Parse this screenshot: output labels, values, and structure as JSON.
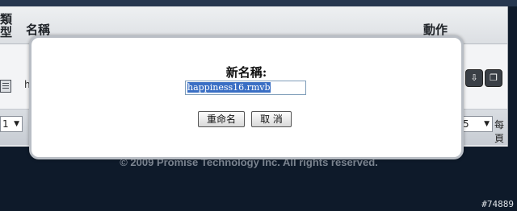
{
  "table": {
    "header_type": "類型",
    "header_name": "名稱",
    "header_action": "動作",
    "row_name_partial": "h"
  },
  "pager": {
    "left_select_value": "1",
    "right_select_value": "5",
    "per_page_label": "每頁"
  },
  "footer": {
    "copyright": "© 2009 Promise Technology Inc. All rights reserved."
  },
  "dialog": {
    "title": "新名稱:",
    "input_value": "happiness16.rmvb",
    "rename_button": "重命名",
    "cancel_button": "取 消"
  },
  "watermark": "#74889",
  "icons": {
    "file": "file-icon",
    "action_1": "download-icon",
    "action_2": "copy-icon"
  }
}
